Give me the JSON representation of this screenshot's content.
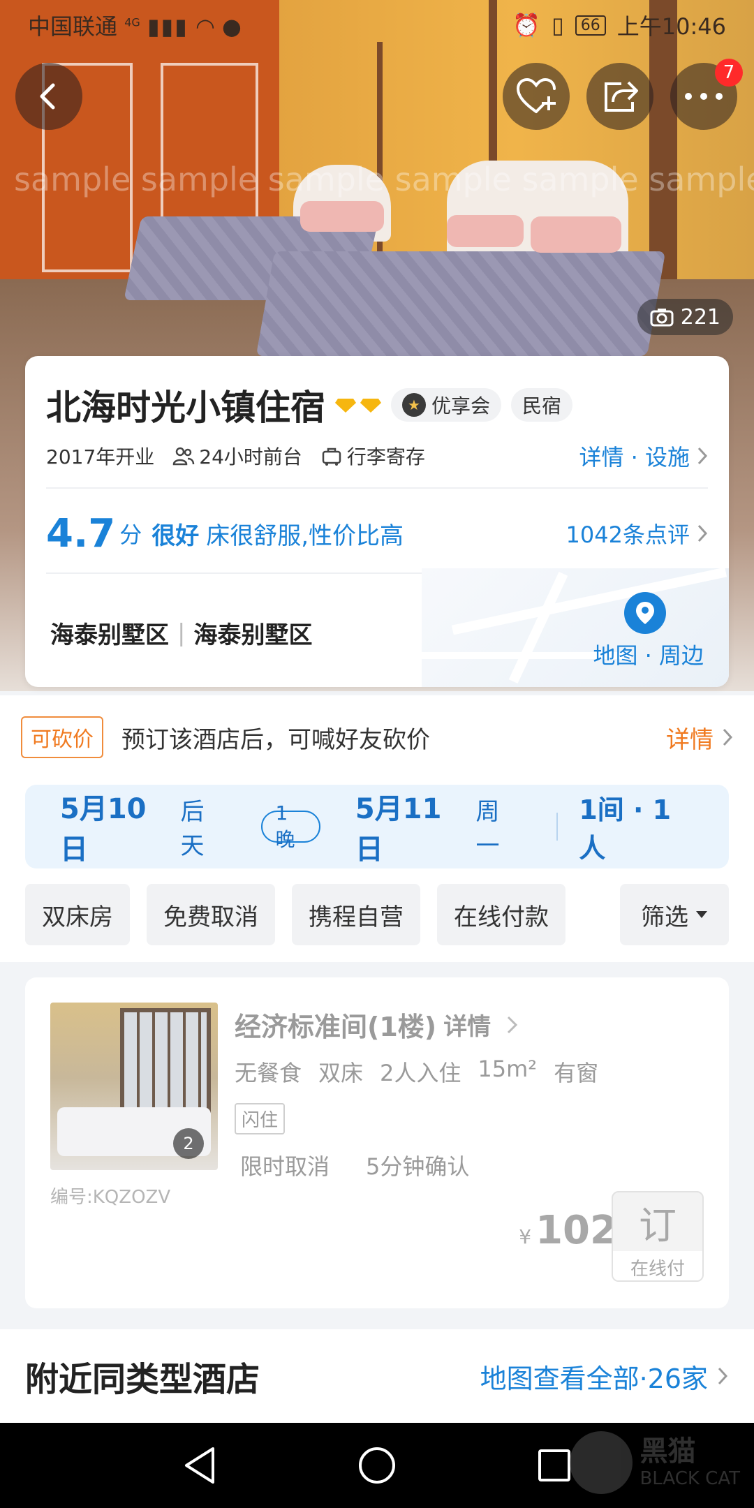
{
  "status_bar": {
    "carrier": "中国联通",
    "network": "4G",
    "battery": "66",
    "time": "上午10:46"
  },
  "hero": {
    "watermark": "sample sample sample sample sample sample",
    "photo_count": "221",
    "notification_count": "7"
  },
  "hotel": {
    "name": "北海时光小镇住宿",
    "vip_label": "优享会",
    "type_tag": "民宿",
    "opened": "2017年开业",
    "facility_1": "24小时前台",
    "facility_2": "行李寄存",
    "details_link": "详情 · 设施",
    "score": "4.7",
    "score_unit": "分",
    "score_word": "很好",
    "score_comment": "床很舒服,性价比高",
    "review_link": "1042条点评",
    "area_1": "海泰别墅区",
    "area_2": "海泰别墅区",
    "map_link": "地图 · 周边"
  },
  "bargain": {
    "tag": "可砍价",
    "text": "预订该酒店后，可喊好友砍价",
    "link": "详情"
  },
  "booking": {
    "checkin_date": "5月10日",
    "checkin_day": "后天",
    "nights": "1晚",
    "checkout_date": "5月11日",
    "checkout_day": "周一",
    "guests": "1间 · 1人"
  },
  "filters": {
    "chips": [
      "双床房",
      "免费取消",
      "携程自营",
      "在线付款"
    ],
    "filter_label": "筛选"
  },
  "room": {
    "name": "经济标准间(1楼)",
    "detail_link": "详情",
    "specs": [
      "无餐食",
      "双床",
      "2人入住",
      "15m²",
      "有窗"
    ],
    "flash_tag": "闪住",
    "policy_1": "限时取消",
    "policy_2": "5分钟确认",
    "image_count": "2",
    "code": "编号:KQZOZV",
    "currency": "¥",
    "price": "102",
    "book_label": "订",
    "pay_label": "在线付"
  },
  "nearby": {
    "title": "附近同类型酒店",
    "link": "地图查看全部·26家"
  },
  "watermark_logo": {
    "line1": "黑猫",
    "line2": "BLACK CAT"
  },
  "colors": {
    "accent_blue": "#1a82d8",
    "bargain_orange": "#f07a20"
  }
}
